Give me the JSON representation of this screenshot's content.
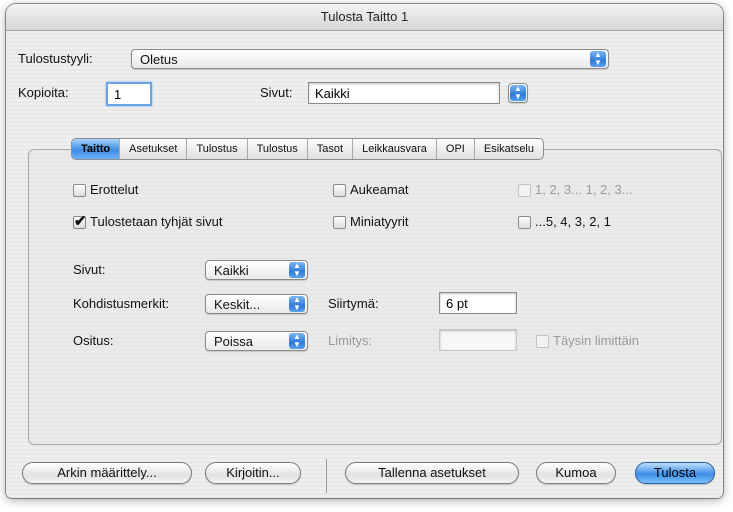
{
  "window": {
    "title": "Tulosta Taitto 1"
  },
  "style_row": {
    "label": "Tulostustyyli:",
    "value": "Oletus"
  },
  "copies": {
    "label": "Kopioita:",
    "value": "1"
  },
  "pages_top": {
    "label": "Sivut:",
    "value": "Kaikki"
  },
  "tabs": [
    {
      "label": "Taitto",
      "selected": true
    },
    {
      "label": "Asetukset"
    },
    {
      "label": "Tulostus"
    },
    {
      "label": "Tulostus"
    },
    {
      "label": "Tasot"
    },
    {
      "label": "Leikkausvara"
    },
    {
      "label": "OPI"
    },
    {
      "label": "Esikatselu"
    }
  ],
  "options": {
    "separations": {
      "label": "Erottelut",
      "checked": false
    },
    "spreads": {
      "label": "Aukeamat",
      "checked": false
    },
    "order_123": {
      "label": "1, 2, 3... 1, 2, 3...",
      "checked": false,
      "disabled": true
    },
    "print_blank": {
      "label": "Tulostetaan tyhjät sivut",
      "checked": true
    },
    "thumbnails": {
      "label": "Miniatyyrit",
      "checked": false
    },
    "order_rev": {
      "label": "...5, 4, 3, 2, 1",
      "checked": false
    }
  },
  "pages": {
    "label": "Sivut:",
    "value": "Kaikki"
  },
  "registration": {
    "label": "Kohdistusmerkit:",
    "value": "Keskit...",
    "offset_label": "Siirtymä:",
    "offset_value": "6 pt"
  },
  "tiling": {
    "label": "Ositus:",
    "value": "Poissa",
    "overlap_label": "Limitys:",
    "overlap_value": "",
    "absolute_overlap_label": "Täysin limittäin"
  },
  "buttons": {
    "page_setup": "Arkin määrittely...",
    "printer": "Kirjoitin...",
    "save_settings": "Tallenna asetukset",
    "cancel": "Kumoa",
    "print": "Tulosta"
  },
  "colors": {
    "accent": "#3e8ee8",
    "window_bg": "#ececec"
  }
}
